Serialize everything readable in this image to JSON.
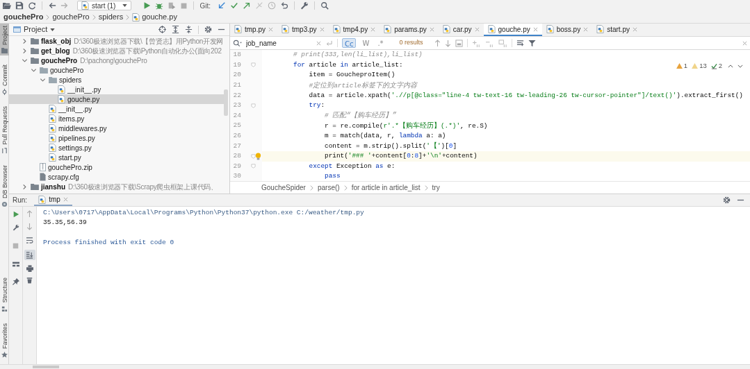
{
  "toolbar": {
    "run_configuration": "start (1)",
    "git_label": "Git:"
  },
  "breadcrumbs": [
    {
      "label": "gouchePro",
      "kind": "project"
    },
    {
      "label": "gouchePro",
      "kind": "folder"
    },
    {
      "label": "spiders",
      "kind": "folder"
    },
    {
      "label": "gouche.py",
      "kind": "python"
    }
  ],
  "side_tools_top": [
    {
      "label": "Project",
      "selected": true
    },
    {
      "label": "Commit",
      "selected": false
    },
    {
      "label": "Pull Requests",
      "selected": false
    },
    {
      "label": "DB Browser",
      "selected": false
    }
  ],
  "side_tools_bottom": [
    {
      "label": "Structure",
      "selected": false
    },
    {
      "label": "Favorites",
      "selected": false
    }
  ],
  "project_panel": {
    "title": "Project",
    "tree": [
      {
        "name": "flask_obj",
        "path": "D:\\360极速浏览器下载\\【曾贤志】用Python开发网",
        "kind": "project",
        "expanded": false,
        "selected": false
      },
      {
        "name": "get_blog",
        "path": "D:\\360极速浏览器下载\\Python自动化办公(面向202",
        "kind": "project",
        "expanded": false,
        "selected": false
      },
      {
        "name": "gouchePro",
        "path": "D:\\pachong\\gouchePro",
        "kind": "project",
        "expanded": true,
        "selected": false,
        "children": [
          {
            "name": "gouchePro",
            "kind": "folder",
            "expanded": true,
            "selected": false,
            "children": [
              {
                "name": "spiders",
                "kind": "folder",
                "expanded": true,
                "selected": false,
                "children": [
                  {
                    "name": "__init__.py",
                    "kind": "python",
                    "selected": false
                  },
                  {
                    "name": "gouche.py",
                    "kind": "python",
                    "selected": true
                  }
                ]
              },
              {
                "name": "__init__.py",
                "kind": "python",
                "selected": false
              },
              {
                "name": "items.py",
                "kind": "python",
                "selected": false
              },
              {
                "name": "middlewares.py",
                "kind": "python",
                "selected": false
              },
              {
                "name": "pipelines.py",
                "kind": "python",
                "selected": false
              },
              {
                "name": "settings.py",
                "kind": "python",
                "selected": false
              },
              {
                "name": "start.py",
                "kind": "python",
                "selected": false
              }
            ]
          },
          {
            "name": "gouchePro.zip",
            "kind": "archive",
            "selected": false
          },
          {
            "name": "scrapy.cfg",
            "kind": "file",
            "selected": false
          }
        ]
      },
      {
        "name": "jianshu",
        "path": "D:\\360极速浏览器下载\\Scrapy爬虫框架上课代码、",
        "kind": "project",
        "expanded": false,
        "selected": false
      }
    ]
  },
  "editor": {
    "tabs": [
      {
        "label": "tmp.py",
        "selected": false
      },
      {
        "label": "tmp3.py",
        "selected": false
      },
      {
        "label": "tmp4.py",
        "selected": false
      },
      {
        "label": "params.py",
        "selected": false
      },
      {
        "label": "car.py",
        "selected": false
      },
      {
        "label": "gouche.py",
        "selected": true
      },
      {
        "label": "boss.py",
        "selected": false
      },
      {
        "label": "start.py",
        "selected": false
      }
    ],
    "search": {
      "value": "job_name",
      "results": "0 results",
      "options": [
        {
          "label": "Cc",
          "selected": true
        },
        {
          "label": "W",
          "selected": false
        },
        {
          "label": ".*",
          "selected": false
        }
      ]
    },
    "inspections": {
      "errors": "1",
      "warnings": "13",
      "typos": "2"
    },
    "lines": [
      {
        "number": "18",
        "fold": false,
        "current": false,
        "segments": [
          {
            "text": "        # print(333,len(li_list),li_list)",
            "kind": "comment"
          }
        ]
      },
      {
        "number": "19",
        "fold": true,
        "current": false,
        "segments": [
          {
            "text": "        for",
            "kind": "keyword"
          },
          {
            "text": " article ",
            "kind": "plain"
          },
          {
            "text": "in",
            "kind": "keyword"
          },
          {
            "text": " article_list:",
            "kind": "plain"
          }
        ]
      },
      {
        "number": "20",
        "fold": false,
        "current": false,
        "segments": [
          {
            "text": "            item = GoucheproItem()",
            "kind": "plain"
          }
        ]
      },
      {
        "number": "21",
        "fold": false,
        "current": false,
        "segments": [
          {
            "text": "            #定位到article标签下的文字内容",
            "kind": "comment"
          }
        ]
      },
      {
        "number": "22",
        "fold": false,
        "current": false,
        "segments": [
          {
            "text": "            data = article.xpath(",
            "kind": "plain"
          },
          {
            "text": "'.//p[@class=\"line-4 tw-text-16 tw-leading-26 tw-cursor-pointer\"]/text()'",
            "kind": "string"
          },
          {
            "text": ").extract_first()",
            "kind": "plain"
          }
        ]
      },
      {
        "number": "23",
        "fold": true,
        "current": false,
        "segments": [
          {
            "text": "            try",
            "kind": "keyword"
          },
          {
            "text": ":",
            "kind": "plain"
          }
        ]
      },
      {
        "number": "24",
        "fold": false,
        "current": false,
        "segments": [
          {
            "text": "                # 匹配“【购车经历】”",
            "kind": "comment"
          }
        ]
      },
      {
        "number": "25",
        "fold": false,
        "current": false,
        "segments": [
          {
            "text": "                r = re.compile(",
            "kind": "plain"
          },
          {
            "text": "r'.*【购车经历】(.*)'",
            "kind": "string"
          },
          {
            "text": ", re.S)",
            "kind": "plain"
          }
        ]
      },
      {
        "number": "26",
        "fold": false,
        "current": false,
        "segments": [
          {
            "text": "                m = match(data, r, ",
            "kind": "plain"
          },
          {
            "text": "lambda",
            "kind": "keyword"
          },
          {
            "text": " a: a)",
            "kind": "plain"
          }
        ]
      },
      {
        "number": "27",
        "fold": false,
        "current": false,
        "segments": [
          {
            "text": "                content = m.strip().split(",
            "kind": "plain"
          },
          {
            "text": "'【'",
            "kind": "string"
          },
          {
            "text": ")[",
            "kind": "plain"
          },
          {
            "text": "0",
            "kind": "number"
          },
          {
            "text": "]",
            "kind": "plain"
          }
        ]
      },
      {
        "number": "28",
        "fold": true,
        "current": true,
        "segments": [
          {
            "text": "                print(",
            "kind": "plain"
          },
          {
            "text": "'### '",
            "kind": "string"
          },
          {
            "text": "+content[",
            "kind": "plain"
          },
          {
            "text": "0",
            "kind": "number"
          },
          {
            "text": ":",
            "kind": "plain"
          },
          {
            "text": "8",
            "kind": "number"
          },
          {
            "text": "]+",
            "kind": "plain"
          },
          {
            "text": "'\\n'",
            "kind": "string"
          },
          {
            "text": "+content)",
            "kind": "plain"
          }
        ]
      },
      {
        "number": "29",
        "fold": true,
        "current": false,
        "segments": [
          {
            "text": "            except",
            "kind": "keyword"
          },
          {
            "text": " Exception ",
            "kind": "plain"
          },
          {
            "text": "as",
            "kind": "keyword"
          },
          {
            "text": " e:",
            "kind": "plain"
          }
        ]
      },
      {
        "number": "30",
        "fold": false,
        "current": false,
        "segments": [
          {
            "text": "                pass",
            "kind": "keyword"
          }
        ]
      }
    ],
    "code_breadcrumbs": [
      "GoucheSpider",
      "parse()",
      "for article in article_list",
      "try"
    ]
  },
  "run_panel": {
    "label": "Run:",
    "tabs": [
      {
        "label": "tmp",
        "selected": true
      }
    ],
    "soft_wrap": false,
    "scroll_to_end": true,
    "output": [
      {
        "text": "C:\\Users\\0717\\AppData\\Local\\Programs\\Python\\Python37\\python.exe C:/weather/tmp.py",
        "kind": "command"
      },
      {
        "text": "35.35,56.39",
        "kind": "stdout"
      },
      {
        "text": "Process finished with exit code 0",
        "kind": "system"
      }
    ]
  }
}
